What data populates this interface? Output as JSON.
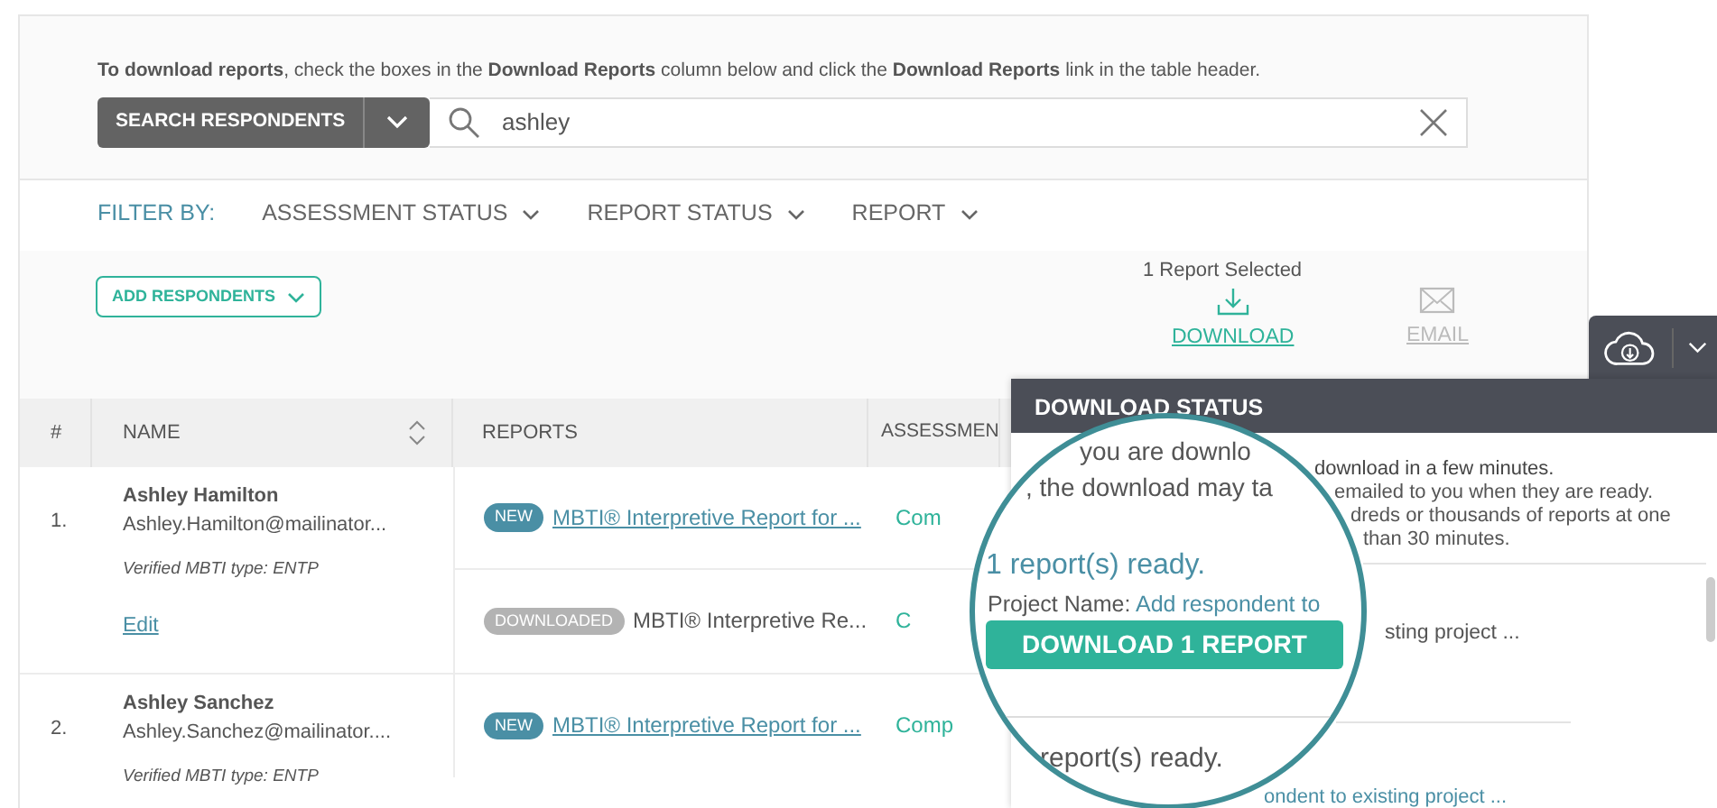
{
  "instructions": "**To download reports**, check the boxes in the **Download Reports** column below and click the **Download Reports** link in the table header.",
  "search": {
    "mode_button": "SEARCH RESPONDENTS",
    "value": "ashley"
  },
  "filters": {
    "label": "FILTER BY:",
    "items": [
      "ASSESSMENT STATUS",
      "REPORT STATUS",
      "REPORT"
    ]
  },
  "add_button": "ADD RESPONDENTS",
  "selection": {
    "count": "1 Report Selected",
    "actions": [
      {
        "kind": "download",
        "label": "DOWNLOAD",
        "disabled": false
      },
      {
        "kind": "email",
        "label": "EMAIL",
        "disabled": true
      }
    ]
  },
  "table": {
    "columns": [
      "#",
      "NAME",
      "REPORTS",
      "ASSESSMEN"
    ],
    "rows": [
      {
        "number": "1.",
        "name": "Ashley Hamilton",
        "email": "Ashley.Hamilton@mailinator...",
        "verified": "Verified MBTI type: ENTP",
        "edit": "Edit",
        "reports": [
          {
            "kind": "new",
            "status": "NEW",
            "title": "MBTI® Interpretive Report for ...",
            "assessment": "Com"
          },
          {
            "kind": "downloaded",
            "status": "DOWNLOADED",
            "title": "MBTI® Interpretive Re...",
            "assessment": "C"
          }
        ]
      },
      {
        "number": "2.",
        "name": "Ashley Sanchez",
        "email": "Ashley.Sanchez@mailinator....",
        "verified": "Verified MBTI type: ENTP",
        "reports": [
          {
            "kind": "new",
            "status": "NEW",
            "title": "MBTI® Interpretive Report for ...",
            "assessment": "Comp"
          }
        ]
      }
    ]
  },
  "download_toggle": {
    "expanded": true
  },
  "download_status": {
    "title": "DOWNLOAD STATUS",
    "lines": [
      "download in a few minutes.",
      "emailed to you when they are ready.",
      "dreds or thousands of reports at one",
      "than 30 minutes.",
      "sting project ...",
      "ondent to existing project ..."
    ]
  },
  "magnifier": {
    "lines": [
      "you are downlo",
      ", the download may ta"
    ],
    "ready": "1 report(s) ready.",
    "project_label": "Project Name:",
    "project_value": "Add respondent to",
    "button": "DOWNLOAD 1 REPORT",
    "next_ready": "report(s) ready."
  }
}
